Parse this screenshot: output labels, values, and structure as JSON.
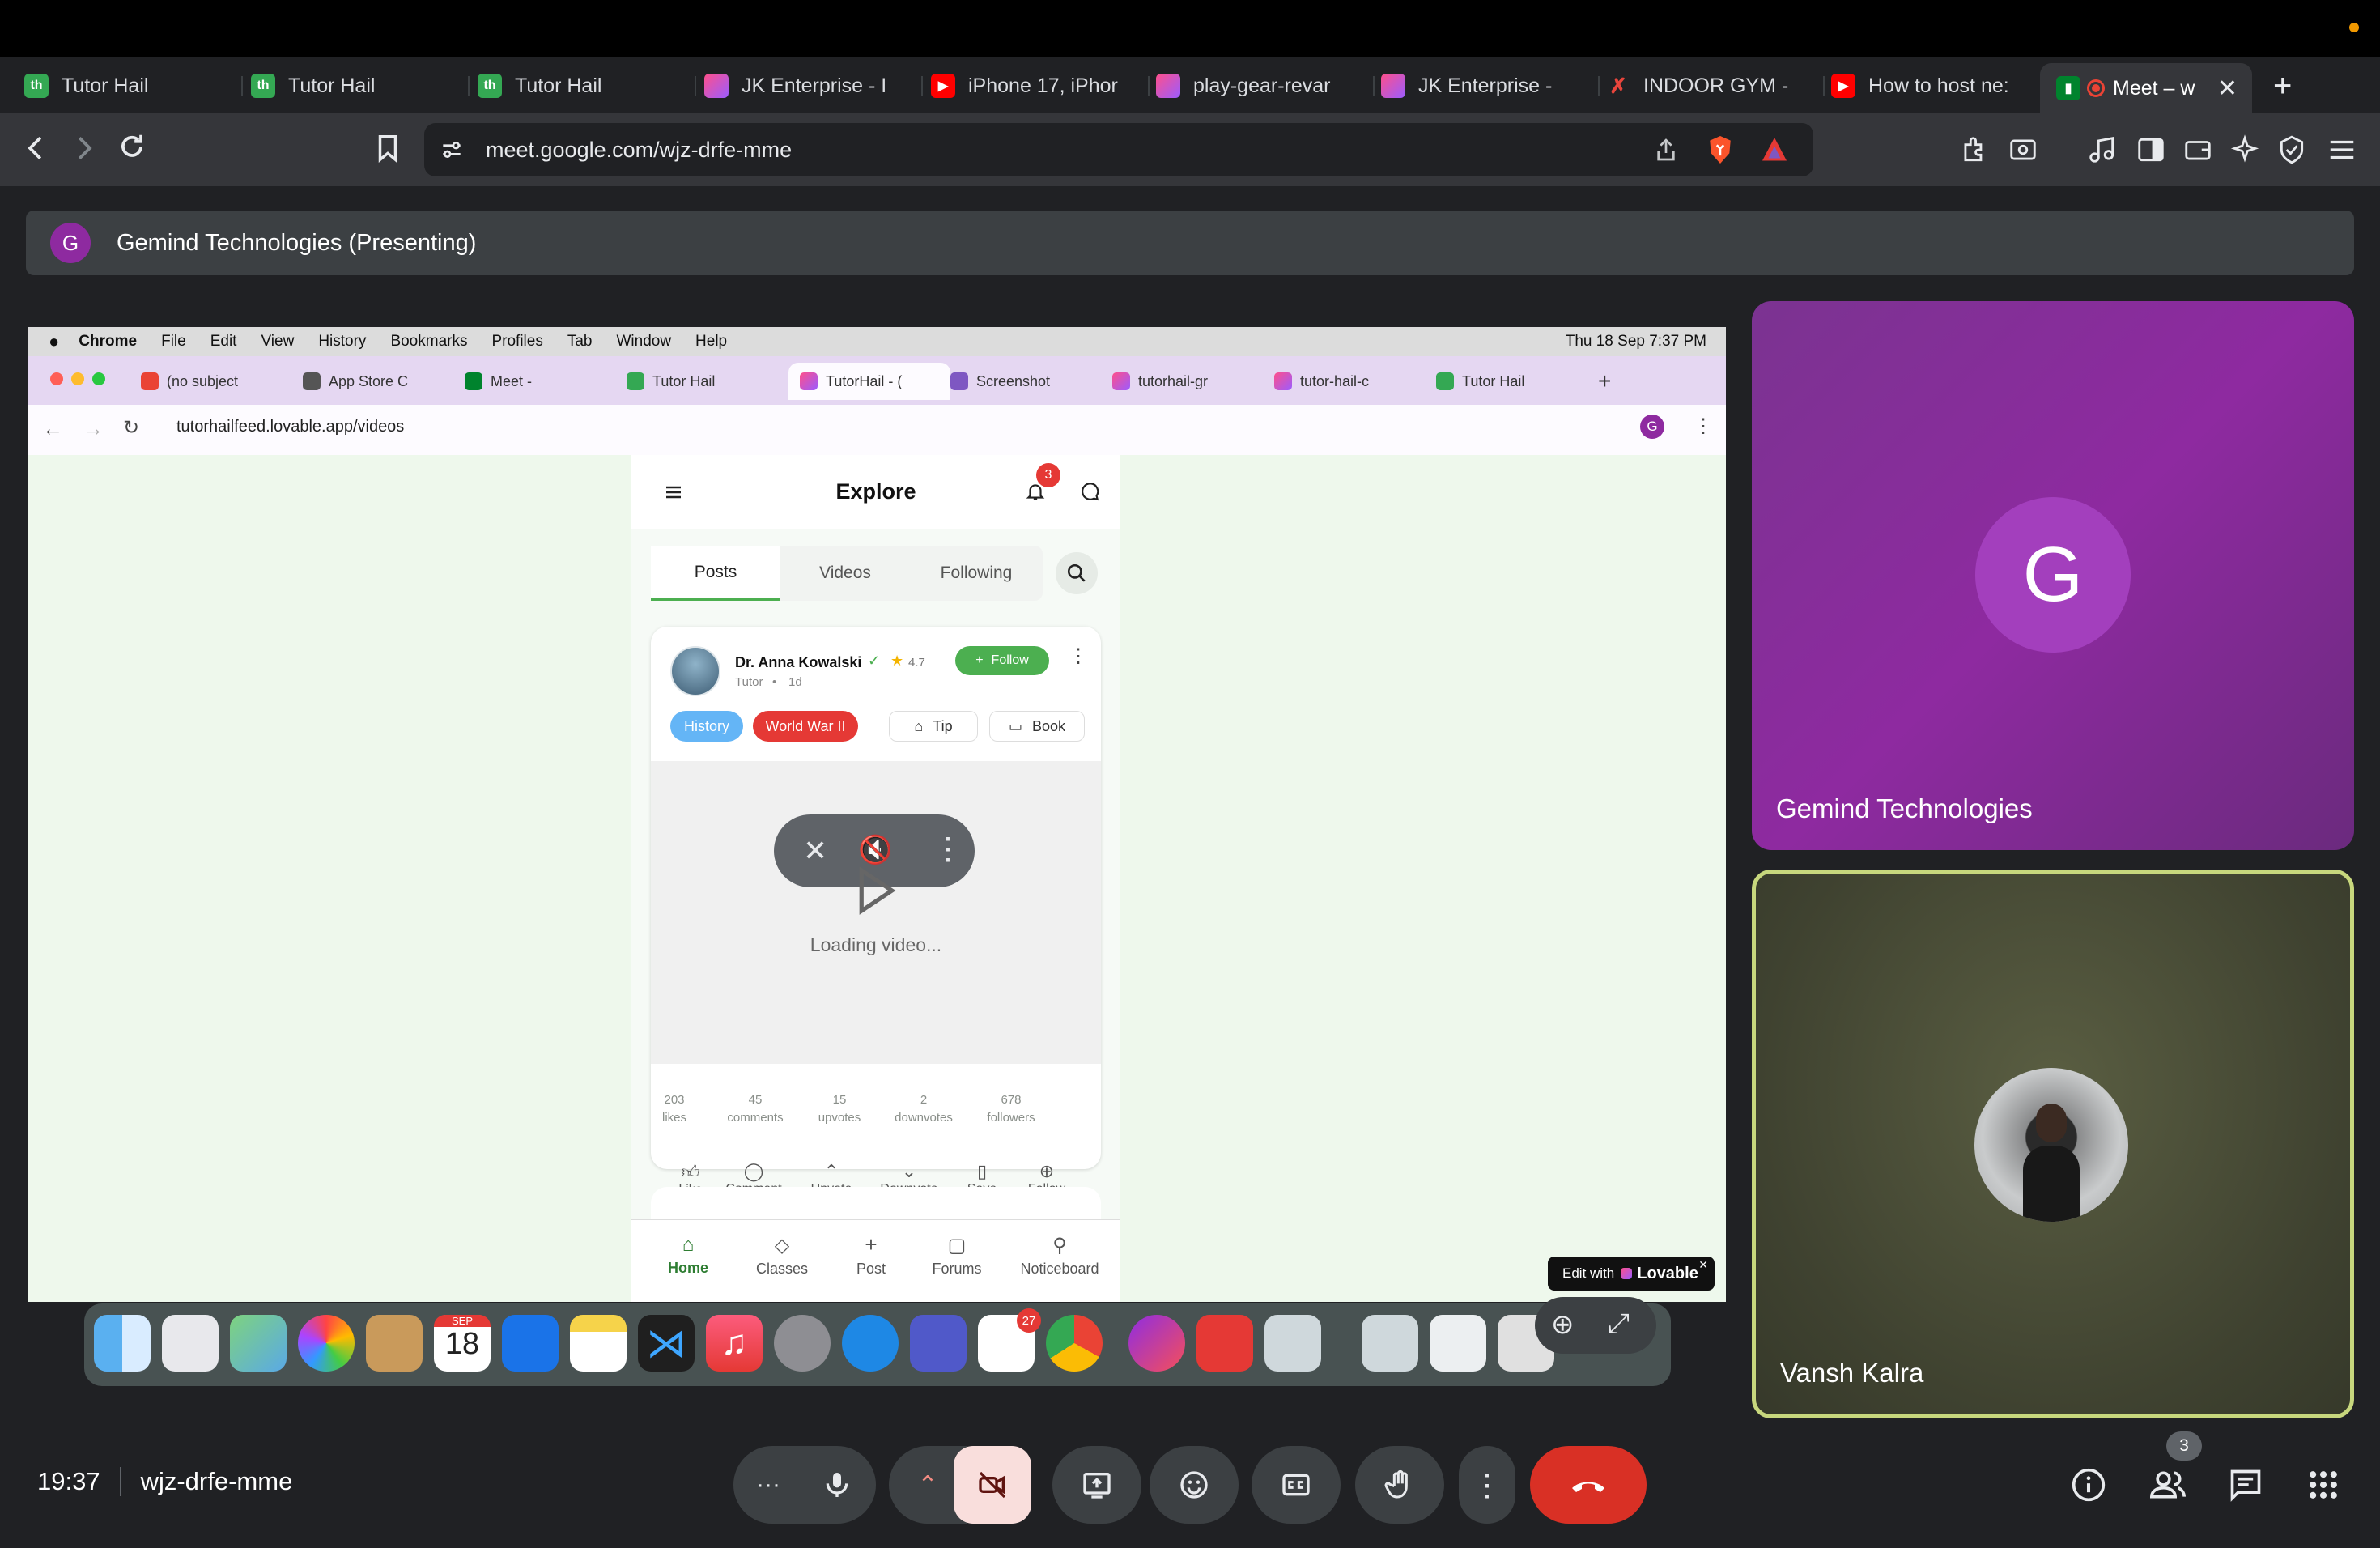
{
  "browser": {
    "tabs": [
      {
        "label": "Tutor Hail",
        "icon": "tutorhail-icon"
      },
      {
        "label": "Tutor Hail",
        "icon": "tutorhail-icon"
      },
      {
        "label": "Tutor Hail",
        "icon": "tutorhail-icon"
      },
      {
        "label": "JK Enterprise - I",
        "icon": "lovable-icon"
      },
      {
        "label": "iPhone 17, iPhor",
        "icon": "youtube-icon"
      },
      {
        "label": "play-gear-revar",
        "icon": "lovable-icon"
      },
      {
        "label": "JK Enterprise -",
        "icon": "lovable-icon"
      },
      {
        "label": "INDOOR GYM -",
        "icon": "x-icon"
      },
      {
        "label": "How to host ne:",
        "icon": "youtube-icon"
      },
      {
        "label": "Meet – w",
        "icon": "meet-icon"
      }
    ],
    "url": "meet.google.com/wjz-drfe-mme"
  },
  "presenting": {
    "avatar_letter": "G",
    "text": "Gemind Technologies (Presenting)"
  },
  "shared_screen": {
    "menu": [
      "Chrome",
      "File",
      "Edit",
      "View",
      "History",
      "Bookmarks",
      "Profiles",
      "Tab",
      "Window",
      "Help"
    ],
    "clock": "Thu 18 Sep  7:37 PM",
    "tabs": [
      "(no subject",
      "App Store C",
      "Meet - ",
      "Tutor Hail",
      "TutorHail - (",
      "Screenshot",
      "tutorhail-gr",
      "tutor-hail-c",
      "Tutor Hail"
    ],
    "url": "tutorhailfeed.lovable.app/videos",
    "profile_letter": "G",
    "app": {
      "title": "Explore",
      "notif_count": "3",
      "tabs": [
        "Posts",
        "Videos",
        "Following"
      ],
      "post": {
        "author": "Dr. Anna Kowalski",
        "rating": "4.7",
        "role": "Tutor",
        "age": "1d",
        "follow": "Follow",
        "tags": [
          "History",
          "World War II"
        ],
        "tip": "Tip",
        "book": "Book",
        "loading": "Loading video...",
        "stats": [
          {
            "n": "203",
            "l": "likes"
          },
          {
            "n": "45",
            "l": "comments"
          },
          {
            "n": "15",
            "l": "upvotes"
          },
          {
            "n": "2",
            "l": "downvotes"
          },
          {
            "n": "678",
            "l": "followers"
          }
        ],
        "actions": [
          "Like",
          "Comment",
          "Upvote",
          "Downvote",
          "Save",
          "Follow"
        ]
      },
      "nav": [
        "Home",
        "Classes",
        "Post",
        "Forums",
        "Noticeboard"
      ]
    },
    "lovable": {
      "prefix": "Edit with",
      "brand": "Lovable"
    },
    "dock": {
      "calendar_month": "SEP",
      "calendar_day": "18",
      "slack_badge": "27"
    }
  },
  "participants": [
    {
      "name": "Gemind Technologies",
      "letter": "G"
    },
    {
      "name": "Vansh Kalra"
    }
  ],
  "meeting": {
    "time": "19:37",
    "code": "wjz-drfe-mme",
    "people_count": "3"
  },
  "colors": {
    "accent_green": "#4caf50",
    "end_call": "#d93025",
    "tile_purple": "#8e2aa0",
    "camera_off": "#f9dedc"
  }
}
